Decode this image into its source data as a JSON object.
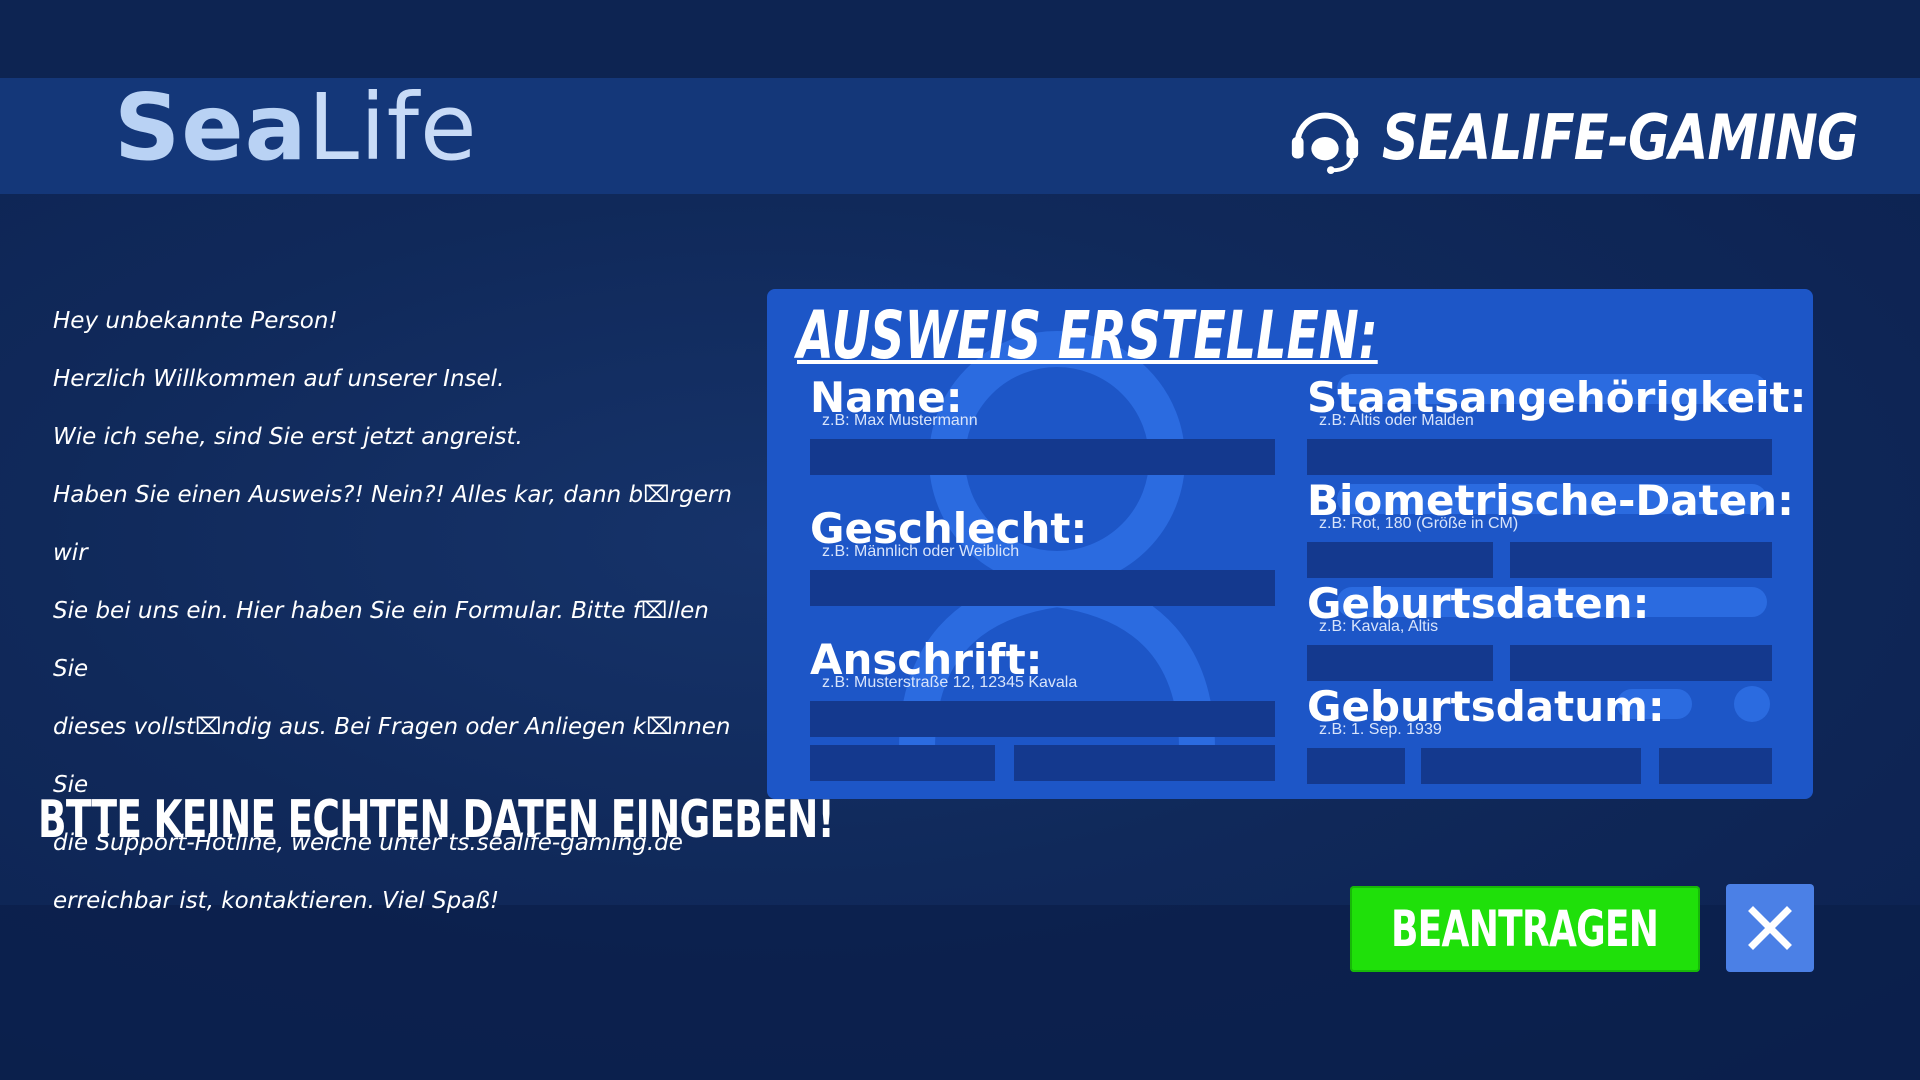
{
  "header": {
    "logo_bold": "Sea",
    "logo_light": "Life",
    "brand_name": "SEALIFE-GAMING",
    "brand_icon": "headset-icon"
  },
  "intro": {
    "greeting": "Hey unbekannte Person!",
    "welcome": "Herzlich Willkommen auf unserer Insel.",
    "arrived": "Wie ich sehe, sind Sie erst jetzt angreist.",
    "lines": [
      "Haben Sie einen Ausweis?! Nein?! Alles kar, dann b⌧rgern wir",
      "Sie bei uns ein. Hier haben Sie ein Formular. Bitte f⌧llen Sie",
      "dieses vollst⌧ndig aus.  Bei Fragen oder Anliegen k⌧nnen Sie",
      "die Support-Hotline, welche  unter ts.sealife-gaming.de",
      "erreichbar ist, kontaktieren. Viel Spaß!"
    ]
  },
  "warning": "BTTE KEINE ECHTEN DATEN EINGEBEN!",
  "form": {
    "title": "AUSWEIS ERSTELLEN:",
    "name": {
      "label": "Name:",
      "hint": "z.B: Max Mustermann"
    },
    "gender": {
      "label": "Geschlecht:",
      "hint": "z.B: Männlich oder Weiblich"
    },
    "address": {
      "label": "Anschrift:",
      "hint": "z.B: Musterstraße 12, 12345 Kavala"
    },
    "nationality": {
      "label": "Staatsangehörigkeit:",
      "hint": "z.B: Altis oder Malden"
    },
    "biometrics": {
      "label": "Biometrische-Daten:",
      "hint": "z.B: Rot, 180 (Größe in CM)"
    },
    "birthplace": {
      "label": "Geburtsdaten:",
      "hint": "z.B: Kavala, Altis"
    },
    "birthdate": {
      "label": "Geburtsdatum:",
      "hint": "z.B: 1. Sep. 1939"
    }
  },
  "buttons": {
    "submit": "BEANTRAGEN",
    "close_icon": "close-icon"
  },
  "colors": {
    "card": "#1d56c7",
    "input": "#14398e",
    "submit": "#1fe00a",
    "close": "#4b80e6"
  }
}
